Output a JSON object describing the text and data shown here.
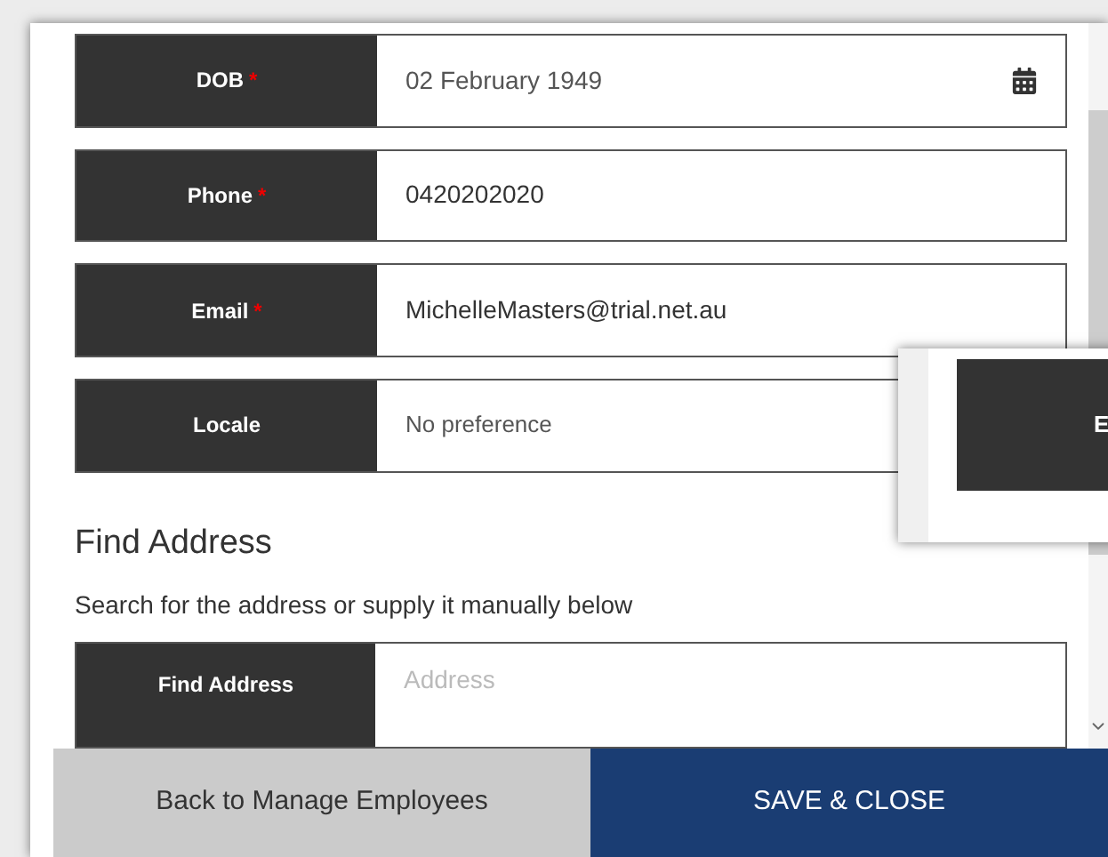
{
  "fields": [
    {
      "label": "DOB",
      "required_mark": "*",
      "value": "02 February 1949",
      "kind": "date"
    },
    {
      "label": "Phone",
      "required_mark": "*",
      "value": "0420202020",
      "kind": "text"
    },
    {
      "label": "Email",
      "required_mark": "*",
      "value": "MichelleMasters@trial.net.au",
      "kind": "text"
    },
    {
      "label": "Locale",
      "value": "No preference",
      "kind": "select"
    }
  ],
  "find_address": {
    "heading": "Find Address",
    "description": "Search for the address or supply it manually below",
    "label": "Find Address",
    "placeholder": "Address"
  },
  "popup": {
    "label": "E"
  },
  "footer": {
    "back_button": "Back to Manage Employees",
    "save_button": "SAVE & CLOSE"
  }
}
